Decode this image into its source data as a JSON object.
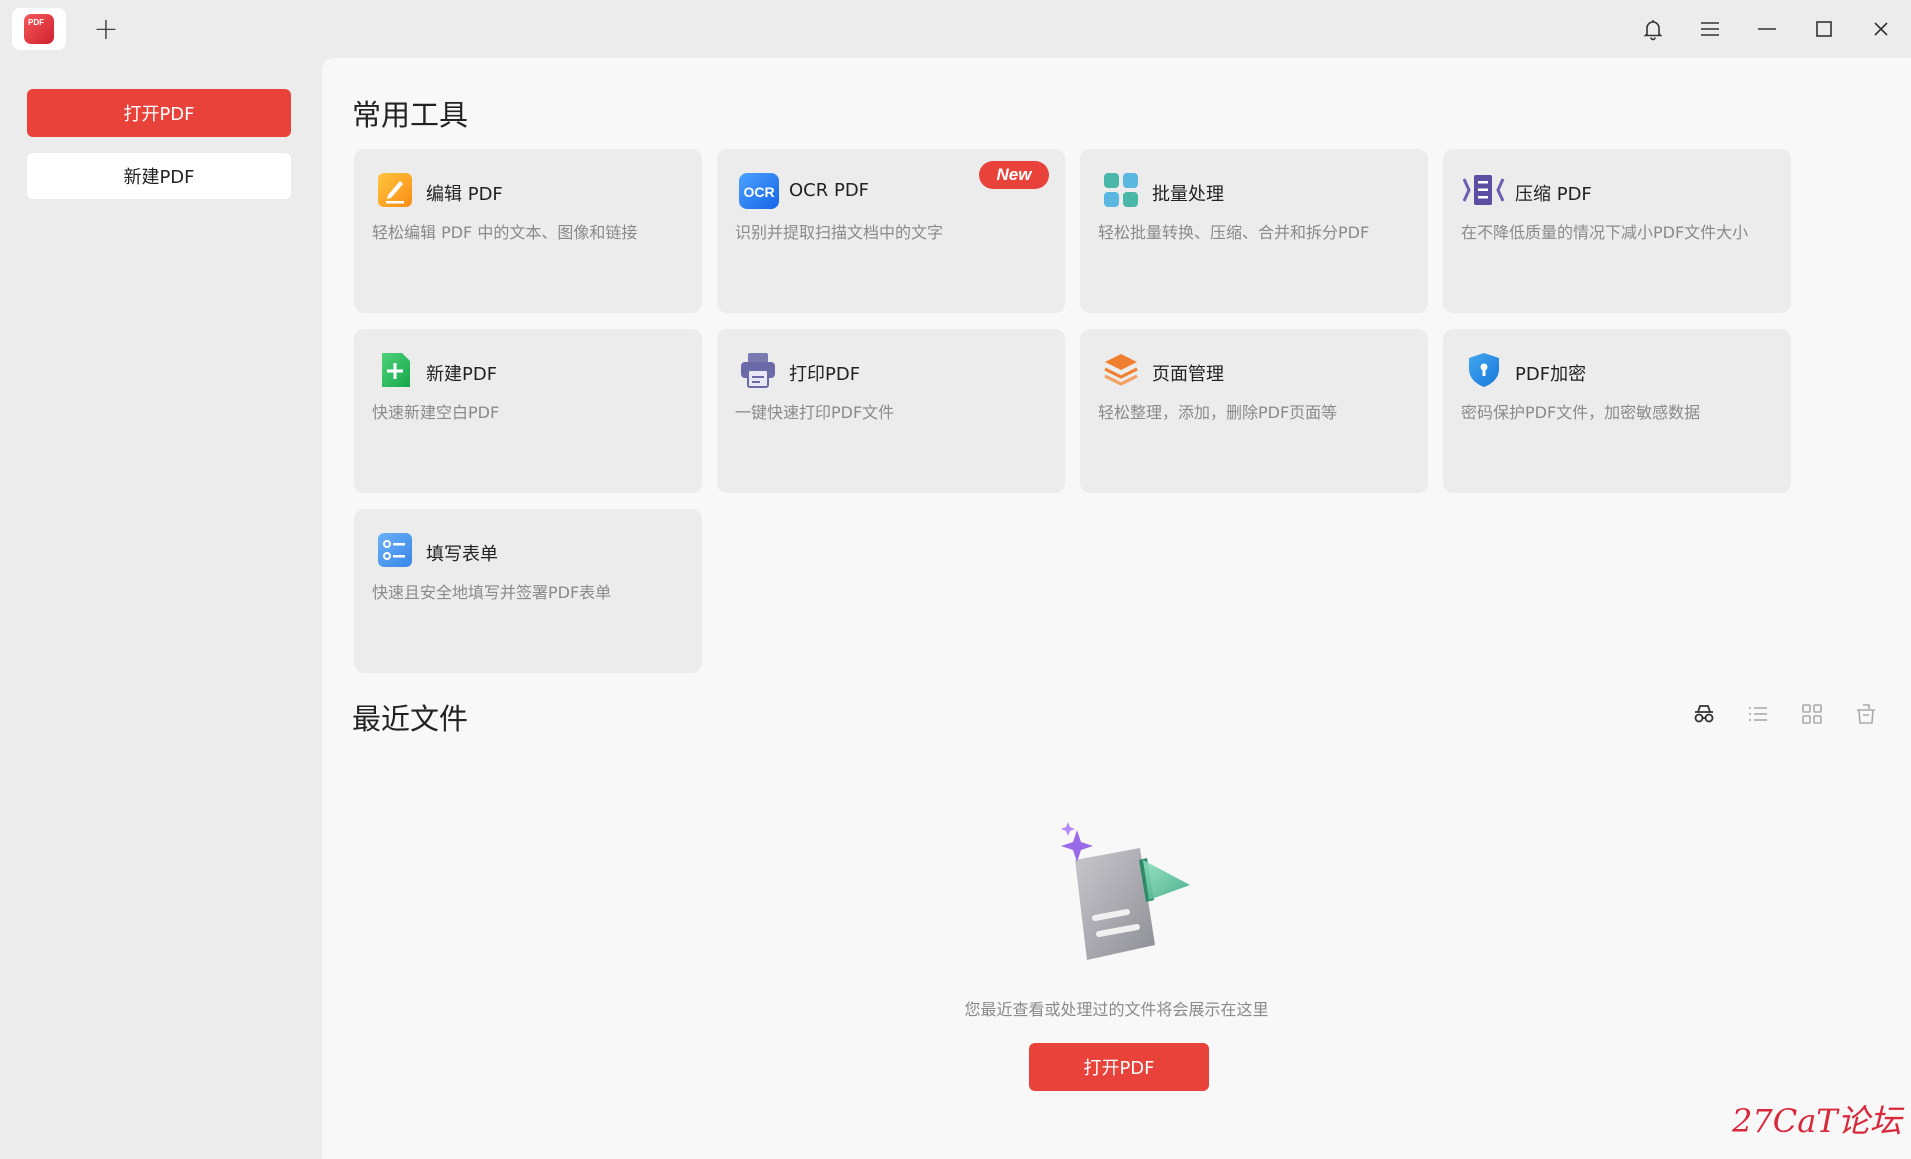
{
  "titlebar": {
    "logo_text": "PDF",
    "new_tab_label": "+"
  },
  "sidebar": {
    "open_label": "打开PDF",
    "new_label": "新建PDF"
  },
  "tools_section": {
    "title": "常用工具",
    "new_badge": "New",
    "tools": [
      {
        "name": "编辑 PDF",
        "desc": "轻松编辑 PDF 中的文本、图像和链接",
        "icon": "edit-icon"
      },
      {
        "name": "OCR PDF",
        "desc": "识别并提取扫描文档中的文字",
        "icon": "ocr-icon"
      },
      {
        "name": "批量处理",
        "desc": "轻松批量转换、压缩、合并和拆分PDF",
        "icon": "batch-icon"
      },
      {
        "name": "压缩 PDF",
        "desc": "在不降低质量的情况下减小PDF文件大小",
        "icon": "compress-icon"
      },
      {
        "name": "新建PDF",
        "desc": "快速新建空白PDF",
        "icon": "new-pdf-icon"
      },
      {
        "name": "打印PDF",
        "desc": "一键快速打印PDF文件",
        "icon": "print-icon"
      },
      {
        "name": "页面管理",
        "desc": "轻松整理，添加，删除PDF页面等",
        "icon": "pages-icon"
      },
      {
        "name": "PDF加密",
        "desc": "密码保护PDF文件，加密敏感数据",
        "icon": "lock-shield-icon"
      },
      {
        "name": "填写表单",
        "desc": "快速且安全地填写并签署PDF表单",
        "icon": "form-icon"
      }
    ]
  },
  "recent_section": {
    "title": "最近文件",
    "empty_text": "您最近查看或处理过的文件将会展示在这里",
    "open_label": "打开PDF"
  },
  "watermark": "27CaT论坛",
  "colors": {
    "accent": "#e8423a",
    "card_bg": "#ececec",
    "main_bg": "#f8f8f8"
  }
}
